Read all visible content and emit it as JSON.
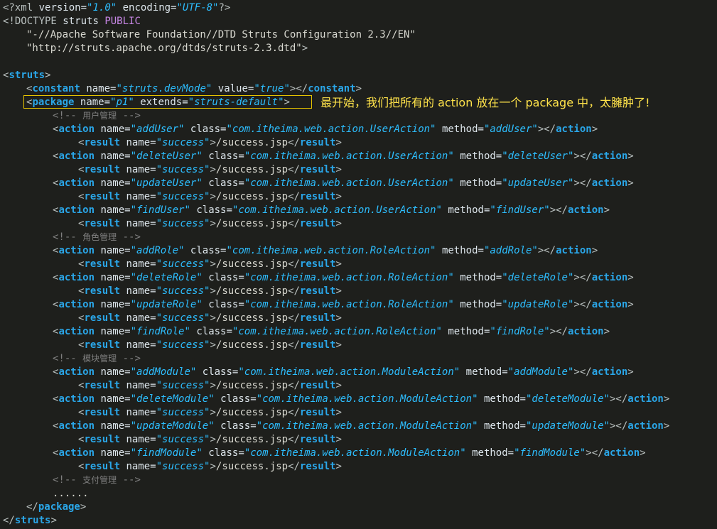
{
  "xml_decl": {
    "open": "<?xml",
    "version_attr": "version=",
    "version_val": "\"1.0\"",
    "encoding_attr": "encoding=",
    "encoding_val": "\"UTF-8\"",
    "close": "?>"
  },
  "doctype": {
    "open": "<!DOCTYPE",
    "name": "struts",
    "keyword": "PUBLIC",
    "public_id": "\"-//Apache Software Foundation//DTD Struts Configuration 2.3//EN\"",
    "system_id": "\"http://struts.apache.org/dtds/struts-2.3.dtd\"",
    "close": ">"
  },
  "tags": {
    "struts": "struts",
    "constant": "constant",
    "package": "package",
    "action": "action",
    "result": "result"
  },
  "attrs": {
    "name": "name=",
    "value": "value=",
    "extends": "extends=",
    "class": "class=",
    "method": "method="
  },
  "constant": {
    "name_val": "\"struts.devMode\"",
    "value_val": "\"true\""
  },
  "package": {
    "name_val": "\"p1\"",
    "extends_val": "\"struts-default\""
  },
  "annotation": "最开始，我们把所有的 action 放在一个 package 中，太臃肿了!",
  "comments": {
    "open": "<!--",
    "close": "-->",
    "user": "用户管理",
    "role": "角色管理",
    "module": "模块管理",
    "pay": "支付管理"
  },
  "result": {
    "name_val": "\"success\"",
    "text": "/success.jsp"
  },
  "actions": {
    "user": [
      {
        "name": "\"addUser\"",
        "cls": "\"com.itheima.web.action.UserAction\"",
        "method": "\"addUser\""
      },
      {
        "name": "\"deleteUser\"",
        "cls": "\"com.itheima.web.action.UserAction\"",
        "method": "\"deleteUser\""
      },
      {
        "name": "\"updateUser\"",
        "cls": "\"com.itheima.web.action.UserAction\"",
        "method": "\"updateUser\""
      },
      {
        "name": "\"findUser\"",
        "cls": "\"com.itheima.web.action.UserAction\"",
        "method": "\"findUser\""
      }
    ],
    "role": [
      {
        "name": "\"addRole\"",
        "cls": "\"com.itheima.web.action.RoleAction\"",
        "method": "\"addRole\""
      },
      {
        "name": "\"deleteRole\"",
        "cls": "\"com.itheima.web.action.RoleAction\"",
        "method": "\"deleteRole\""
      },
      {
        "name": "\"updateRole\"",
        "cls": "\"com.itheima.web.action.RoleAction\"",
        "method": "\"updateRole\""
      },
      {
        "name": "\"findRole\"",
        "cls": "\"com.itheima.web.action.RoleAction\"",
        "method": "\"findRole\""
      }
    ],
    "module": [
      {
        "name": "\"addModule\"",
        "cls": "\"com.itheima.web.action.ModuleAction\"",
        "method": "\"addModule\""
      },
      {
        "name": "\"deleteModule\"",
        "cls": "\"com.itheima.web.action.ModuleAction\"",
        "method": "\"deleteModule\""
      },
      {
        "name": "\"updateModule\"",
        "cls": "\"com.itheima.web.action.ModuleAction\"",
        "method": "\"updateModule\""
      },
      {
        "name": "\"findModule\"",
        "cls": "\"com.itheima.web.action.ModuleAction\"",
        "method": "\"findModule\""
      }
    ]
  },
  "ellipsis": "......",
  "colors": {
    "background": "#1e1f1c",
    "tag": "#2aa6e8",
    "string": "#2dbeff",
    "attribute": "#dde6ec",
    "declaration": "#c887e6",
    "comment": "#7f7f7f",
    "highlight_box": "#e5c300",
    "annotation_text": "#ffe34a"
  }
}
